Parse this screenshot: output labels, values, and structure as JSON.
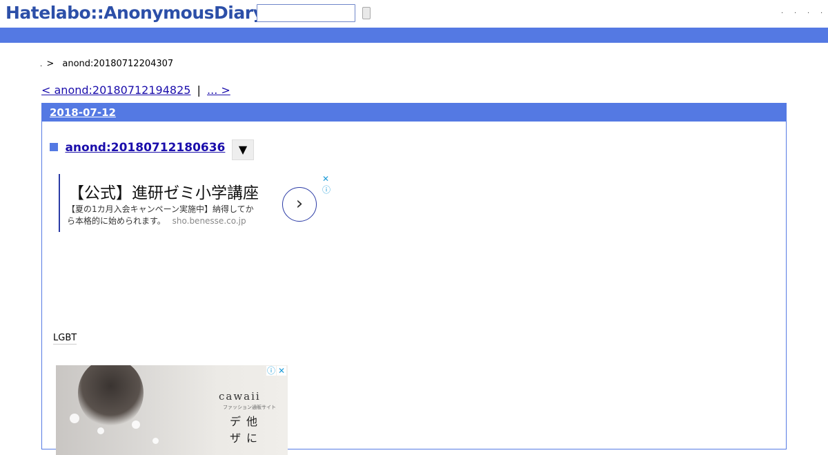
{
  "header": {
    "logo": "Hatelabo::AnonymousDiary",
    "search_placeholder": "",
    "menu_dots": [
      "·",
      "·",
      "·",
      "·"
    ]
  },
  "breadcrumb": {
    "dot": ".",
    "separator": ">",
    "current": "anond:20180712204307"
  },
  "pager": {
    "prev_label": "< anond:20180712194825",
    "divider": "|",
    "next_label": "... >"
  },
  "day": {
    "date": "2018-07-12",
    "entry": {
      "title": "anond:20180712180636",
      "toggle": "▼",
      "tag": "LGBT"
    }
  },
  "ad1": {
    "title": "【公式】進研ゼミ小学講座",
    "body_line1": "【夏の1カ月入会キャンペーン実施中】納得してか",
    "body_line2": "ら本格的に始められます。",
    "domain": "sho.benesse.co.jp",
    "arrow": "›",
    "close": "✕",
    "info": "ⓘ"
  },
  "ad2": {
    "brand": "cawaii",
    "subtitle": "ファッション通販サイト",
    "vertical_col1": "デザ",
    "vertical_col2": "他に",
    "info": "ⓘ",
    "close": "✕"
  },
  "colors": {
    "accent": "#5479e3",
    "link": "#1a0dab",
    "logo": "#2c4fa8"
  }
}
